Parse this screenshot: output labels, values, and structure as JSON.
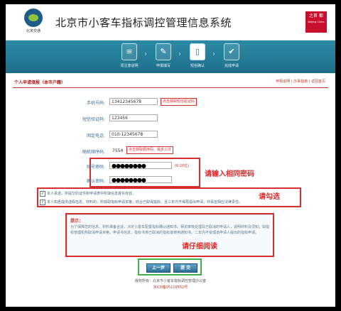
{
  "header": {
    "logo_caption": "北京交通",
    "system_title": "北京市小客车指标调控管理信息系统",
    "stamp_text": "之首 都",
    "stamp_subtext": "Beijing China"
  },
  "steps": [
    {
      "label": "须注意说明",
      "icon": "document-icon",
      "glyph": "≡",
      "active": false
    },
    {
      "label": "申报填写",
      "icon": "form-edit-icon",
      "glyph": "✎",
      "active": false
    },
    {
      "label": "短信确认",
      "icon": "mobile-phone-icon",
      "glyph": "▯",
      "active": true
    },
    {
      "label": "完成申请",
      "icon": "checkmark-icon",
      "glyph": "✔",
      "active": false
    }
  ],
  "panel": {
    "title": "个人申请填报（本市户籍）",
    "links": [
      "申报说明",
      "办事指南",
      "返回首页"
    ]
  },
  "form": {
    "phone_label": "手机号码:",
    "phone_value": "13412345678",
    "phone_note": "点击获取短信验证码",
    "sms_label": "短信验证码:",
    "sms_value": "123456",
    "fixed_label": "固定电话:",
    "fixed_value": "010-12345678",
    "random_label": "随机顺序码:",
    "random_value": "7554",
    "random_note": "点击获取顺序码，最多三次",
    "account_label": "账号密码:",
    "account_value": "●●●●●●●●",
    "account_hint": "(6-20位)",
    "confirm_label": "确认密码:",
    "confirm_value": "●●●●●●●●"
  },
  "callouts": {
    "password": "请输入相同密码",
    "checkbox": "请勾选",
    "read": "请仔细阅读"
  },
  "agreements": [
    "本人承诺，所提交的证件和申请表中所填信息真实有效。",
    "本人知悉提供虚假信息、材料的，所获取指标申请资格，结合已取得指标，且三年内不得再提出申请，并承担相应法律责任。"
  ],
  "tips": {
    "heading": "提示：",
    "body": "为了保障您的信息、材料准备合适，决定小客车配置指标确认通知书。相关审核处理及已取消的申请人，说明材料及须知；由指标管理机构取消申请资格，申请书信息，指标书将已取消的指标或使用通知书。二年内不受理该申请人提出的指标申请。"
  },
  "buttons": {
    "prev": "上一步",
    "submit": "提 交"
  },
  "footer": {
    "line1": "版权所有：北京市小客车指标调控管理办公室",
    "line2": "京ICP备05116552号"
  }
}
